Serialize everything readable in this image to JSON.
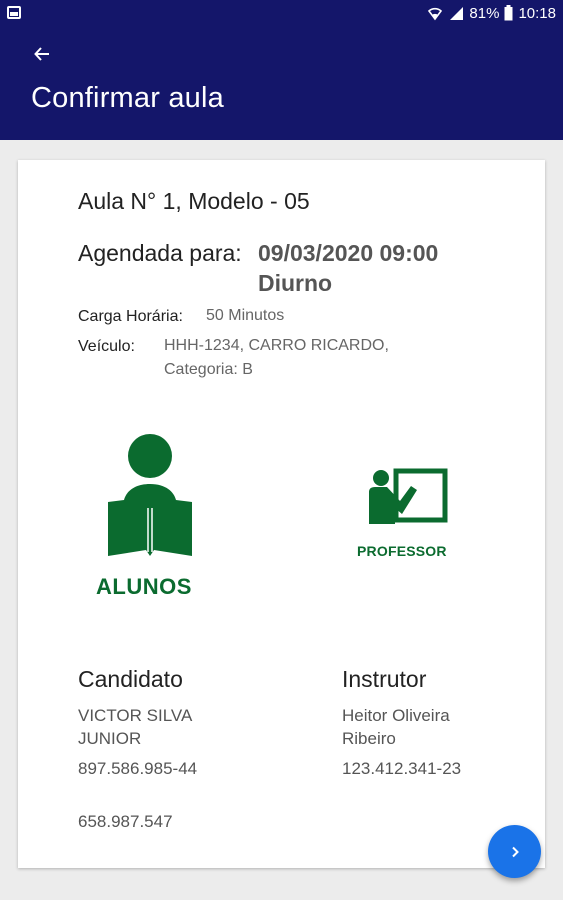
{
  "status_bar": {
    "battery": "81%",
    "time": "10:18"
  },
  "app_bar": {
    "title": "Confirmar aula"
  },
  "lesson": {
    "title": "Aula N° 1, Modelo - 05",
    "scheduled_label": "Agendada para:",
    "scheduled_datetime": "09/03/2020 09:00",
    "period": "Diurno",
    "workload_label": "Carga Horária:",
    "workload_value": "50 Minutos",
    "vehicle_label": "Veículo:",
    "vehicle_line1": "HHH-1234, CARRO RICARDO,",
    "vehicle_line2": "Categoria: B"
  },
  "icons": {
    "students_label": "ALUNOS",
    "teacher_label": "PROFESSOR",
    "color": "#0b6b2f"
  },
  "candidate": {
    "heading": "Candidato",
    "name_line1": "VICTOR SILVA",
    "name_line2": "JUNIOR",
    "cpf": "897.586.985-44",
    "id": "658.987.547"
  },
  "instructor": {
    "heading": "Instrutor",
    "name_line1": "Heitor Oliveira",
    "name_line2": "Ribeiro",
    "cpf": "123.412.341-23"
  },
  "fab": {
    "icon": "chevron-right-icon",
    "color": "#1a73e8"
  },
  "theme": {
    "primary": "#14166a",
    "background": "#ececec"
  }
}
